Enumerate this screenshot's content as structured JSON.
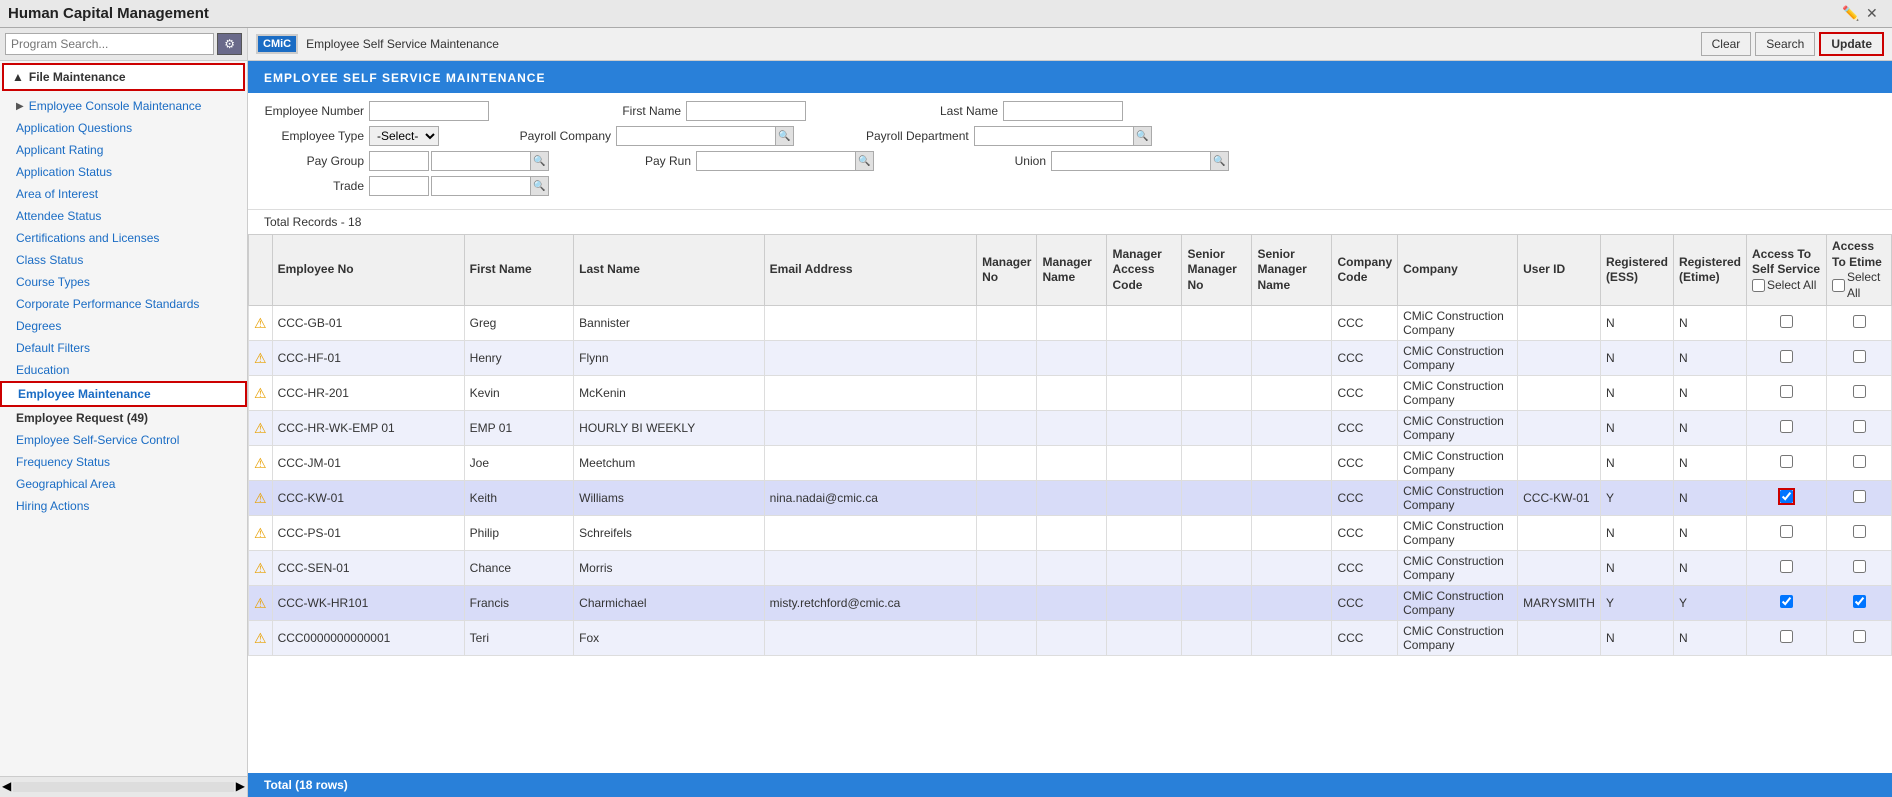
{
  "app": {
    "title": "Human Capital Management"
  },
  "sidebar": {
    "search_placeholder": "Program Search...",
    "file_maintenance_label": "File Maintenance",
    "items": [
      {
        "id": "employee-console",
        "label": "Employee Console Maintenance",
        "sub": true
      },
      {
        "id": "application-questions",
        "label": "Application Questions",
        "sub": false
      },
      {
        "id": "applicant-rating",
        "label": "Applicant Rating",
        "sub": false
      },
      {
        "id": "application-status",
        "label": "Application Status",
        "sub": false
      },
      {
        "id": "area-of-interest",
        "label": "Area of Interest",
        "sub": false
      },
      {
        "id": "attendee-status",
        "label": "Attendee Status",
        "sub": false
      },
      {
        "id": "certifications-licenses",
        "label": "Certifications and Licenses",
        "sub": false
      },
      {
        "id": "class-status",
        "label": "Class Status",
        "sub": false
      },
      {
        "id": "course-types",
        "label": "Course Types",
        "sub": false
      },
      {
        "id": "corporate-performance",
        "label": "Corporate Performance Standards",
        "sub": false
      },
      {
        "id": "degrees",
        "label": "Degrees",
        "sub": false
      },
      {
        "id": "default-filters",
        "label": "Default Filters",
        "sub": false
      },
      {
        "id": "education",
        "label": "Education",
        "sub": false
      },
      {
        "id": "employee-maintenance",
        "label": "Employee Maintenance",
        "sub": false,
        "active": true
      },
      {
        "id": "employee-request",
        "label": "Employee Request (49)",
        "sub": false,
        "bold": true
      },
      {
        "id": "employee-self-service",
        "label": "Employee Self-Service Control",
        "sub": false
      },
      {
        "id": "frequency-status",
        "label": "Frequency Status",
        "sub": false
      },
      {
        "id": "geographical-area",
        "label": "Geographical Area",
        "sub": false
      },
      {
        "id": "hiring-actions",
        "label": "Hiring Actions",
        "sub": false
      }
    ]
  },
  "content_header": {
    "logo": "CMiC",
    "title": "Employee Self Service Maintenance",
    "btn_clear": "Clear",
    "btn_search": "Search",
    "btn_update": "Update"
  },
  "page_title": "EMPLOYEE SELF SERVICE MAINTENANCE",
  "search_form": {
    "employee_number_label": "Employee Number",
    "first_name_label": "First Name",
    "last_name_label": "Last Name",
    "employee_type_label": "Employee Type",
    "employee_type_default": "-Select-",
    "payroll_company_label": "Payroll Company",
    "payroll_department_label": "Payroll Department",
    "pay_group_label": "Pay Group",
    "pay_run_label": "Pay Run",
    "union_label": "Union",
    "trade_label": "Trade"
  },
  "table": {
    "total_records": "Total Records - 18",
    "columns": [
      {
        "id": "emp-no",
        "label": "Employee No"
      },
      {
        "id": "first-name",
        "label": "First Name"
      },
      {
        "id": "last-name",
        "label": "Last Name"
      },
      {
        "id": "email",
        "label": "Email Address"
      },
      {
        "id": "manager-no",
        "label": "Manager No"
      },
      {
        "id": "manager-name",
        "label": "Manager Name"
      },
      {
        "id": "manager-access",
        "label": "Manager Access Code"
      },
      {
        "id": "senior-manager-no",
        "label": "Senior Manager No"
      },
      {
        "id": "senior-manager-name",
        "label": "Senior Manager Name"
      },
      {
        "id": "company-code",
        "label": "Company Code"
      },
      {
        "id": "company",
        "label": "Company"
      },
      {
        "id": "user-id",
        "label": "User ID"
      },
      {
        "id": "registered-ess",
        "label": "Registered (ESS)"
      },
      {
        "id": "registered-etime",
        "label": "Registered (Etime)"
      },
      {
        "id": "access-self-service",
        "label": "Access To Self Service"
      },
      {
        "id": "access-etime",
        "label": "Access To Etime"
      }
    ],
    "rows": [
      {
        "emp_no": "CCC-GB-01",
        "first": "Greg",
        "last": "Bannister",
        "email": "",
        "mgr_no": "",
        "mgr_name": "",
        "mgr_access": "",
        "sr_mgr_no": "",
        "sr_mgr_name": "",
        "co_code": "CCC",
        "company": "CMiC Construction Company",
        "user_id": "",
        "reg_ess": "N",
        "reg_etime": "N",
        "access_ss": false,
        "access_etime": false,
        "highlight": false
      },
      {
        "emp_no": "CCC-HF-01",
        "first": "Henry",
        "last": "Flynn",
        "email": "",
        "mgr_no": "",
        "mgr_name": "",
        "mgr_access": "",
        "sr_mgr_no": "",
        "sr_mgr_name": "",
        "co_code": "CCC",
        "company": "CMiC Construction Company",
        "user_id": "",
        "reg_ess": "N",
        "reg_etime": "N",
        "access_ss": false,
        "access_etime": false,
        "highlight": false
      },
      {
        "emp_no": "CCC-HR-201",
        "first": "Kevin",
        "last": "McKenin",
        "email": "",
        "mgr_no": "",
        "mgr_name": "",
        "mgr_access": "",
        "sr_mgr_no": "",
        "sr_mgr_name": "",
        "co_code": "CCC",
        "company": "CMiC Construction Company",
        "user_id": "",
        "reg_ess": "N",
        "reg_etime": "N",
        "access_ss": false,
        "access_etime": false,
        "highlight": false
      },
      {
        "emp_no": "CCC-HR-WK-EMP 01",
        "first": "EMP 01",
        "last": "HOURLY BI WEEKLY",
        "email": "",
        "mgr_no": "",
        "mgr_name": "",
        "mgr_access": "",
        "sr_mgr_no": "",
        "sr_mgr_name": "",
        "co_code": "CCC",
        "company": "CMiC Construction Company",
        "user_id": "",
        "reg_ess": "N",
        "reg_etime": "N",
        "access_ss": false,
        "access_etime": false,
        "highlight": false
      },
      {
        "emp_no": "CCC-JM-01",
        "first": "Joe",
        "last": "Meetchum",
        "email": "",
        "mgr_no": "",
        "mgr_name": "",
        "mgr_access": "",
        "sr_mgr_no": "",
        "sr_mgr_name": "",
        "co_code": "CCC",
        "company": "CMiC Construction Company",
        "user_id": "",
        "reg_ess": "N",
        "reg_etime": "N",
        "access_ss": false,
        "access_etime": false,
        "highlight": false
      },
      {
        "emp_no": "CCC-KW-01",
        "first": "Keith",
        "last": "Williams",
        "email": "nina.nadai@cmic.ca",
        "mgr_no": "",
        "mgr_name": "",
        "mgr_access": "",
        "sr_mgr_no": "",
        "sr_mgr_name": "",
        "co_code": "CCC",
        "company": "CMiC Construction Company",
        "user_id": "CCC-KW-01",
        "reg_ess": "Y",
        "reg_etime": "N",
        "access_ss": true,
        "access_etime": false,
        "highlight": true,
        "access_ss_selected": true
      },
      {
        "emp_no": "CCC-PS-01",
        "first": "Philip",
        "last": "Schreifels",
        "email": "",
        "mgr_no": "",
        "mgr_name": "",
        "mgr_access": "",
        "sr_mgr_no": "",
        "sr_mgr_name": "",
        "co_code": "CCC",
        "company": "CMiC Construction Company",
        "user_id": "",
        "reg_ess": "N",
        "reg_etime": "N",
        "access_ss": false,
        "access_etime": false,
        "highlight": false
      },
      {
        "emp_no": "CCC-SEN-01",
        "first": "Chance",
        "last": "Morris",
        "email": "",
        "mgr_no": "",
        "mgr_name": "",
        "mgr_access": "",
        "sr_mgr_no": "",
        "sr_mgr_name": "",
        "co_code": "CCC",
        "company": "CMiC Construction Company",
        "user_id": "",
        "reg_ess": "N",
        "reg_etime": "N",
        "access_ss": false,
        "access_etime": false,
        "highlight": false
      },
      {
        "emp_no": "CCC-WK-HR101",
        "first": "Francis",
        "last": "Charmichael",
        "email": "misty.retchford@cmic.ca",
        "mgr_no": "",
        "mgr_name": "",
        "mgr_access": "",
        "sr_mgr_no": "",
        "sr_mgr_name": "",
        "co_code": "CCC",
        "company": "CMiC Construction Company",
        "user_id": "MARYSMITH",
        "reg_ess": "Y",
        "reg_etime": "Y",
        "access_ss": true,
        "access_etime": true,
        "highlight": true
      },
      {
        "emp_no": "CCC0000000000001",
        "first": "Teri",
        "last": "Fox",
        "email": "",
        "mgr_no": "",
        "mgr_name": "",
        "mgr_access": "",
        "sr_mgr_no": "",
        "sr_mgr_name": "",
        "co_code": "CCC",
        "company": "CMiC Construction Company",
        "user_id": "",
        "reg_ess": "N",
        "reg_etime": "N",
        "access_ss": false,
        "access_etime": false,
        "highlight": false
      }
    ],
    "footer": "Total  (18 rows)"
  }
}
